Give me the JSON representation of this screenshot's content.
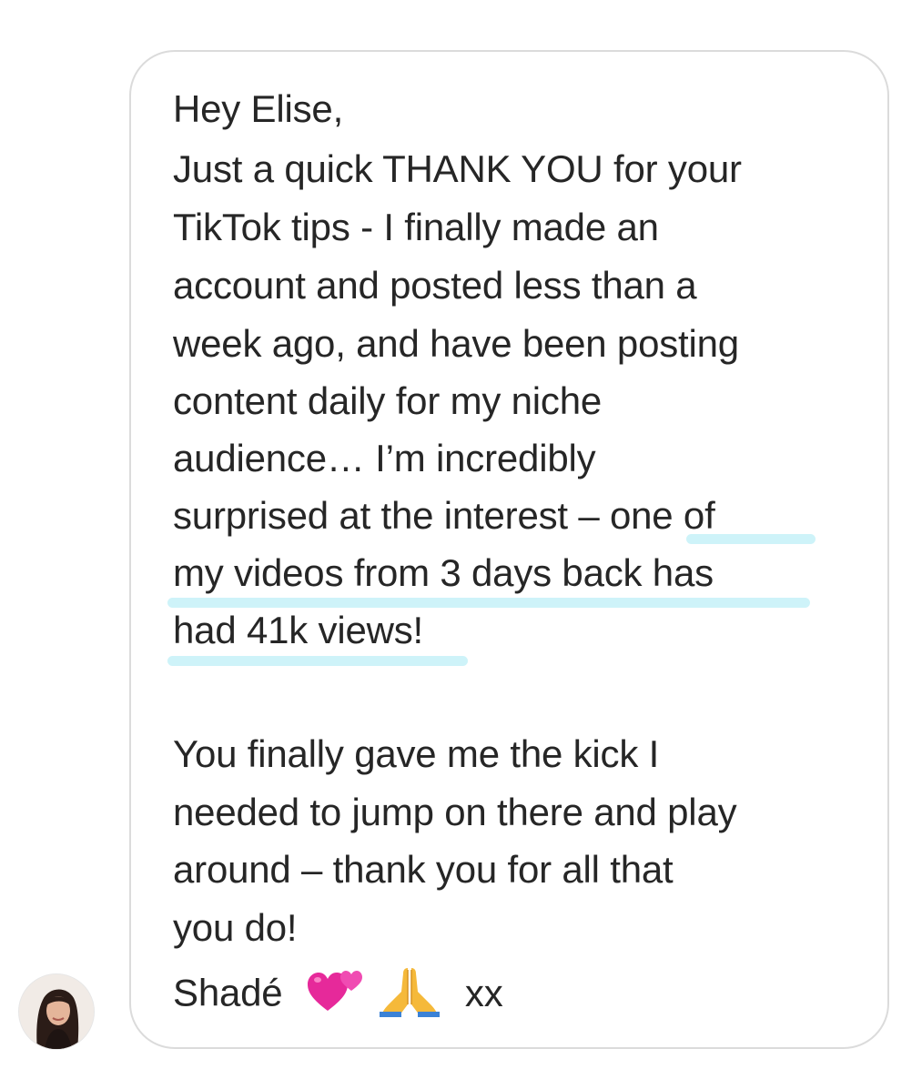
{
  "message": {
    "lines": [
      "Hey Elise,",
      "Just a quick THANK YOU for your",
      "TikTok tips - I finally made an",
      "account and posted less than a",
      "week ago, and have been posting",
      "content daily for my niche",
      "audience… I’m incredibly",
      "surprised at the interest – one of",
      "my videos from 3 days back has",
      "had 41k views!",
      "",
      "You finally gave me the kick I",
      "needed to jump on there and play",
      "around – thank you for all that",
      "you do!"
    ],
    "signature": {
      "name": "Shadé",
      "emojis": [
        "two-hearts-emoji",
        "folded-hands-emoji"
      ],
      "closing": "xx"
    }
  },
  "colors": {
    "bubble_border": "#dbdbdb",
    "highlight": "#c9f2f8",
    "text": "#262626"
  }
}
